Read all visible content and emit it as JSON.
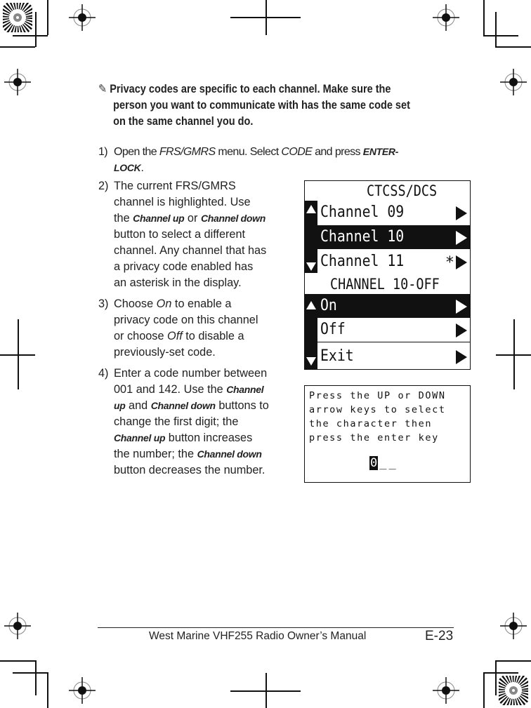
{
  "note": {
    "icon": "note-pencil-icon",
    "lines": [
      "Privacy codes are specific to each channel. Make sure the",
      "person you want to communicate with has the same code set",
      "on the same channel you do."
    ]
  },
  "steps": [
    {
      "num": "1)",
      "parts": [
        "Open the ",
        "FRS/GMRS",
        " menu. Select ",
        "CODE",
        " and press ",
        "ENTER-",
        "LOCK",
        "."
      ]
    },
    {
      "num": "2)",
      "lines": [
        "The current FRS/GMRS",
        "channel is highlighted. Use",
        "the ",
        "Channel up",
        " or ",
        "Channel down",
        "button to select a different",
        "channel. Any channel that has",
        "a privacy code enabled has",
        "an asterisk in the display."
      ]
    },
    {
      "num": "3)",
      "lines": [
        "Choose ",
        "On",
        " to enable a",
        "privacy code on this channel",
        "or choose ",
        "Off",
        " to disable a",
        "previously-set code."
      ]
    },
    {
      "num": "4)",
      "lines": [
        "Enter a code number between",
        "001 and 142. Use the ",
        "Channel",
        "up",
        " and ",
        "Channel down",
        " buttons to",
        "change the first digit; the",
        "Channel up",
        " button increases",
        "the number; the ",
        "Channel down",
        "button decreases the number."
      ]
    }
  ],
  "screen1": {
    "title": "CTCSS/DCS",
    "rows": [
      {
        "label": "Channel 09",
        "asterisk": "",
        "selected": false
      },
      {
        "label": "Channel 10",
        "asterisk": "",
        "selected": true
      },
      {
        "label": "Channel 11",
        "asterisk": "*",
        "selected": false
      }
    ]
  },
  "screen2": {
    "title": "CHANNEL 10-OFF",
    "rows": [
      {
        "label": "On",
        "selected": true
      },
      {
        "label": "Off",
        "selected": false
      },
      {
        "label": "Exit",
        "selected": false
      }
    ]
  },
  "screen3": {
    "prompt": "Press the UP or DOWN\narrow keys to select\nthe character then\npress the enter key",
    "cursor_char": "0",
    "blanks": "__"
  },
  "footer": {
    "title": "West Marine VHF255 Radio Owner’s Manual",
    "page": "E-23"
  }
}
